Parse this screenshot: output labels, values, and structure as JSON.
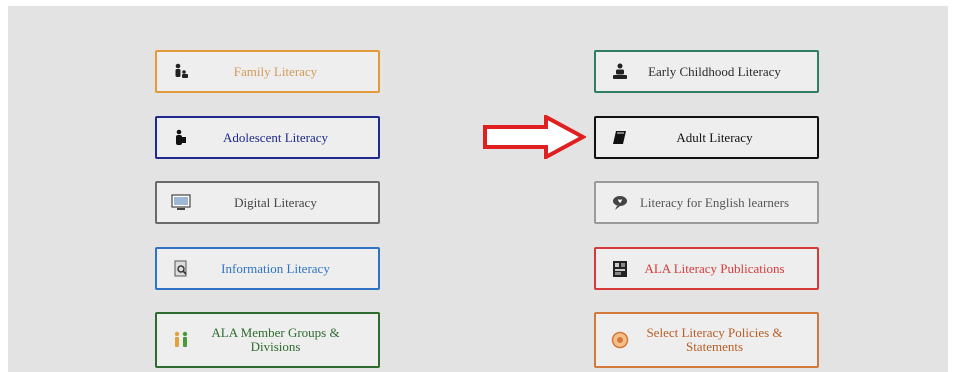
{
  "buttons": [
    {
      "key": "family",
      "label": "Family Literacy",
      "color": "#e39a3b",
      "text": "#d39a56",
      "icon": "family-icon"
    },
    {
      "key": "early",
      "label": "Early Childhood Literacy",
      "color": "#2f7d63",
      "text": "#2a2a2a",
      "icon": "early-childhood-icon"
    },
    {
      "key": "adolescent",
      "label": "Adolescent Literacy",
      "color": "#1f2a8c",
      "text": "#1f2a8c",
      "icon": "adolescent-icon"
    },
    {
      "key": "adult",
      "label": "Adult Literacy",
      "color": "#111111",
      "text": "#111111",
      "icon": "book-icon"
    },
    {
      "key": "digital",
      "label": "Digital Literacy",
      "color": "#6a6a6a",
      "text": "#444444",
      "icon": "monitor-icon"
    },
    {
      "key": "english",
      "label": "Literacy for English learners",
      "color": "#9a9a9a",
      "text": "#555555",
      "icon": "speech-heart-icon"
    },
    {
      "key": "information",
      "label": "Information Literacy",
      "color": "#2f73c4",
      "text": "#2f73c4",
      "icon": "document-search-icon"
    },
    {
      "key": "publications",
      "label": "ALA Literacy Publications",
      "color": "#d83a3a",
      "text": "#d83a3a",
      "icon": "publication-icon"
    },
    {
      "key": "member",
      "label": "ALA Member Groups & Divisions",
      "color": "#2e6b2e",
      "text": "#2e6b2e",
      "icon": "people-icon"
    },
    {
      "key": "policies",
      "label": "Select Literacy Policies & Statements",
      "color": "#d2793b",
      "text": "#b85d27",
      "icon": "badge-icon"
    }
  ],
  "arrow": {
    "color": "#e02020",
    "icon": "right-arrow-icon"
  }
}
